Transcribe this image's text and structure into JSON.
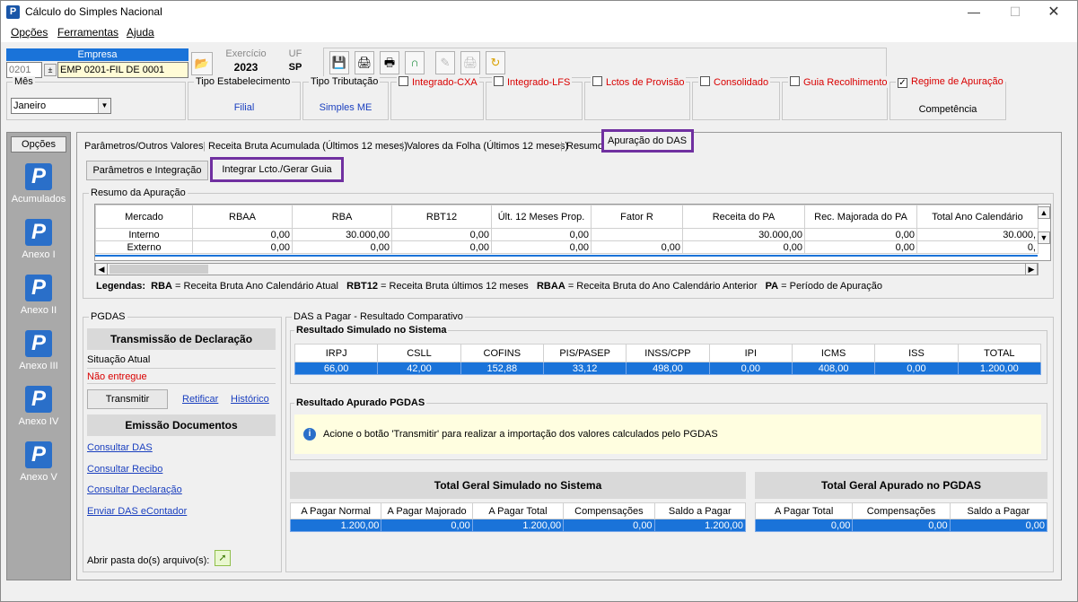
{
  "window": {
    "title": "Cálculo do Simples Nacional",
    "icon": "P"
  },
  "menu": [
    "Opções",
    "Ferramentas",
    "Ajuda"
  ],
  "header": {
    "empresa_label": "Empresa",
    "empresa_code": "0201",
    "empresa_name": "EMP 0201-FIL DE 0001",
    "exercicio_label": "Exercício",
    "exercicio_value": "2023",
    "uf_label": "UF",
    "uf_value": "SP"
  },
  "filters": {
    "mes_label": "Mês",
    "mes_value": "Janeiro",
    "tipo_estab_label": "Tipo Estabelecimento",
    "tipo_estab_value": "Filial",
    "tipo_trib_label": "Tipo Tributação",
    "tipo_trib_value": "Simples ME",
    "checks": [
      {
        "label": "Integrado-CXA",
        "checked": false
      },
      {
        "label": "Integrado-LFS",
        "checked": false
      },
      {
        "label": "Lctos de Provisão",
        "checked": false
      },
      {
        "label": "Consolidado",
        "checked": false
      },
      {
        "label": "Guia Recolhimento",
        "checked": false
      },
      {
        "label": "Regime de Apuração",
        "checked": true
      }
    ],
    "regime_value": "Competência"
  },
  "sidebar": {
    "header": "Opções",
    "items": [
      "Acumulados",
      "Anexo I",
      "Anexo II",
      "Anexo III",
      "Anexo IV",
      "Anexo V"
    ]
  },
  "tabs": [
    "Parâmetros/Outros Valores",
    "Receita Bruta Acumulada (Últimos 12 meses)",
    "Valores da Folha (Últimos 12 meses)",
    "Resumo",
    "Apuração do DAS"
  ],
  "subbuttons": {
    "params": "Parâmetros e Integração",
    "integrar": "Integrar Lcto./Gerar Guia"
  },
  "resumo": {
    "title": "Resumo da Apuração",
    "columns": [
      "Mercado",
      "RBAA",
      "RBA",
      "RBT12",
      "Últ. 12 Meses Prop.",
      "Fator R",
      "Receita do PA",
      "Rec. Majorada do PA",
      "Total Ano Calendário"
    ],
    "rows": [
      [
        "Interno",
        "0,00",
        "30.000,00",
        "0,00",
        "0,00",
        "",
        "30.000,00",
        "0,00",
        "30.000,"
      ],
      [
        "Externo",
        "0,00",
        "0,00",
        "0,00",
        "0,00",
        "0,00",
        "0,00",
        "0,00",
        "0,"
      ]
    ],
    "legend": {
      "prefix": "Legendas:",
      "items": [
        {
          "key": "RBA",
          "desc": " = Receita Bruta Ano Calendário Atual"
        },
        {
          "key": "RBT12",
          "desc": " = Receita Bruta últimos 12 meses"
        },
        {
          "key": "RBAA",
          "desc": " = Receita Bruta do Ano Calendário Anterior"
        },
        {
          "key": "PA",
          "desc": " = Período de Apuração"
        }
      ]
    }
  },
  "pgdas": {
    "title": "PGDAS",
    "transmissao": "Transmissão de Declaração",
    "situacao_label": "Situação Atual",
    "situacao_value": "Não entregue",
    "transmitir": "Transmitir",
    "retificar": "Retificar",
    "historico": "Histórico",
    "emissao": "Emissão Documentos",
    "links": [
      "Consultar DAS",
      "Consultar Recibo",
      "Consultar Declaração",
      "Enviar DAS eContador"
    ],
    "abrir_pasta": "Abrir pasta do(s) arquivo(s):"
  },
  "das": {
    "title": "DAS a Pagar - Resultado Comparativo",
    "simulado_title": "Resultado Simulado no Sistema",
    "simulado_cols": [
      "IRPJ",
      "CSLL",
      "COFINS",
      "PIS/PASEP",
      "INSS/CPP",
      "IPI",
      "ICMS",
      "ISS",
      "TOTAL"
    ],
    "simulado_vals": [
      "66,00",
      "42,00",
      "152,88",
      "33,12",
      "498,00",
      "0,00",
      "408,00",
      "0,00",
      "1.200,00"
    ],
    "apurado_title": "Resultado Apurado PGDAS",
    "apurado_msg": "Acione o botão 'Transmitir' para realizar a importação dos valores calculados pelo PGDAS",
    "total_sim_title": "Total Geral Simulado no Sistema",
    "total_sim_cols": [
      "A Pagar Normal",
      "A Pagar Majorado",
      "A Pagar Total",
      "Compensações",
      "Saldo a Pagar"
    ],
    "total_sim_vals": [
      "1.200,00",
      "0,00",
      "1.200,00",
      "0,00",
      "1.200,00"
    ],
    "total_ap_title": "Total Geral Apurado no PGDAS",
    "total_ap_cols": [
      "A Pagar Total",
      "Compensações",
      "Saldo a Pagar"
    ],
    "total_ap_vals": [
      "0,00",
      "0,00",
      "0,00"
    ]
  }
}
